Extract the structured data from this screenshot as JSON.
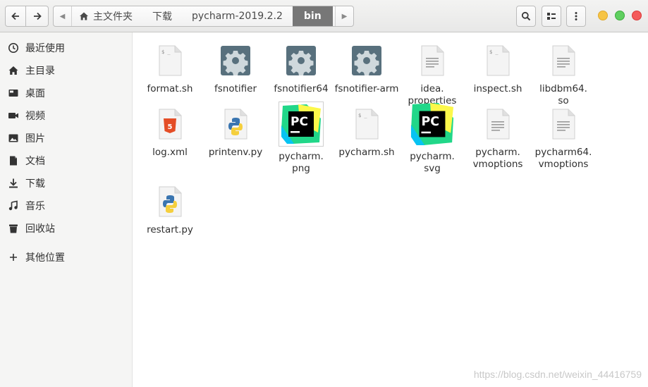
{
  "header": {
    "path": [
      "主文件夹",
      "下载",
      "pycharm-2019.2.2",
      "bin"
    ]
  },
  "sidebar": {
    "items": [
      {
        "label": "最近使用",
        "icon": "clock-icon"
      },
      {
        "label": "主目录",
        "icon": "home-icon"
      },
      {
        "label": "桌面",
        "icon": "desktop-icon"
      },
      {
        "label": "视频",
        "icon": "video-icon"
      },
      {
        "label": "图片",
        "icon": "picture-icon"
      },
      {
        "label": "文档",
        "icon": "document-icon"
      },
      {
        "label": "下载",
        "icon": "download-icon"
      },
      {
        "label": "音乐",
        "icon": "music-icon"
      },
      {
        "label": "回收站",
        "icon": "trash-icon"
      }
    ],
    "other": {
      "label": "其他位置",
      "icon": "plus-icon"
    }
  },
  "files": [
    {
      "name": "format.sh",
      "type": "script"
    },
    {
      "name": "fsnotifier",
      "type": "exec"
    },
    {
      "name": "fsnotifier64",
      "type": "exec"
    },
    {
      "name": "fsnotifier-arm",
      "type": "exec"
    },
    {
      "name": "idea.\nproperties",
      "type": "text"
    },
    {
      "name": "inspect.sh",
      "type": "script"
    },
    {
      "name": "libdbm64.\nso",
      "type": "text"
    },
    {
      "name": "log.xml",
      "type": "html"
    },
    {
      "name": "printenv.py",
      "type": "python"
    },
    {
      "name": "pycharm.\npng",
      "type": "pycharm-png"
    },
    {
      "name": "pycharm.sh",
      "type": "script"
    },
    {
      "name": "pycharm.\nsvg",
      "type": "pycharm-svg"
    },
    {
      "name": "pycharm.\nvmoptions",
      "type": "text"
    },
    {
      "name": "pycharm64.\nvmoptions",
      "type": "text"
    },
    {
      "name": "restart.py",
      "type": "python"
    }
  ],
  "watermark": "https://blog.csdn.net/weixin_44416759"
}
